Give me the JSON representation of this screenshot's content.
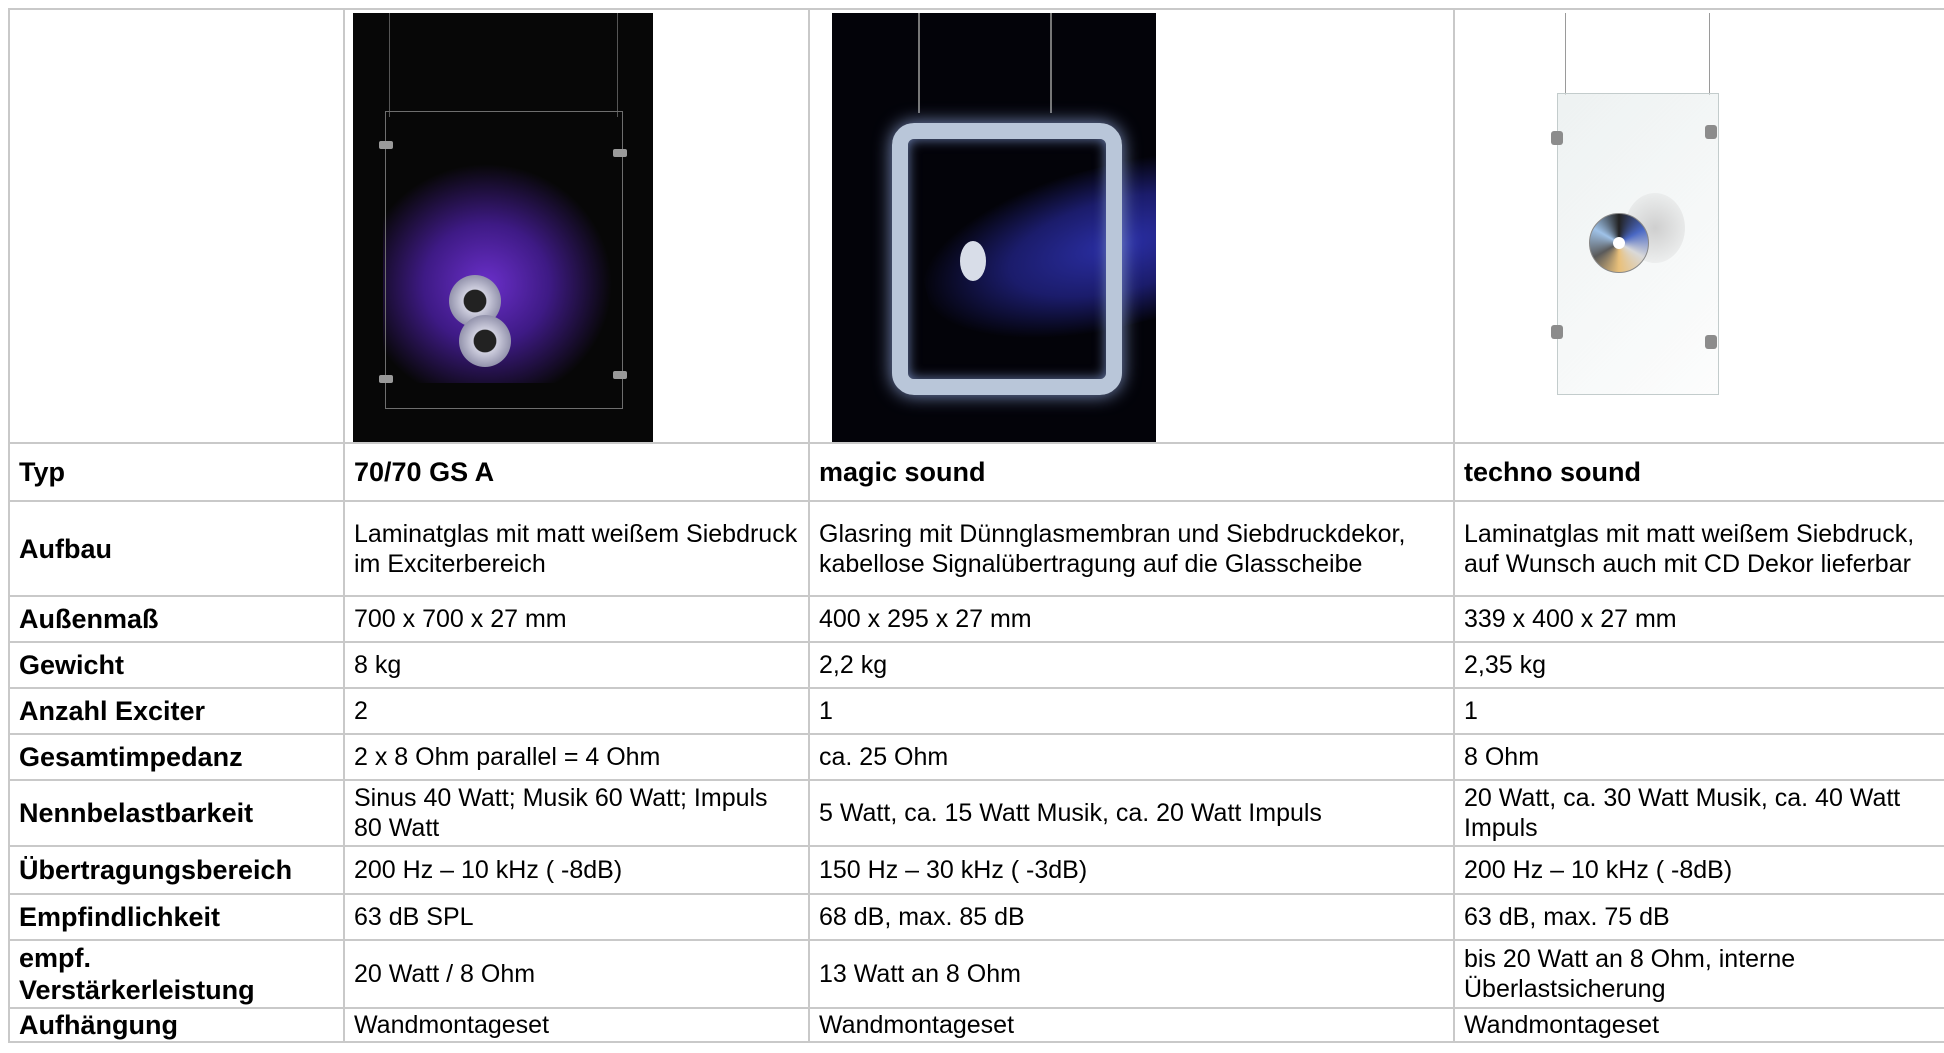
{
  "table": {
    "images": [
      {
        "icon": "suspended-glass-speaker-photo"
      },
      {
        "icon": "glass-ring-speaker-photo"
      },
      {
        "icon": "cd-decor-glass-speaker-photo"
      }
    ],
    "rows": [
      {
        "label": "Typ",
        "values": [
          "70/70 GS A",
          "magic sound",
          "techno sound"
        ]
      },
      {
        "label": "Aufbau",
        "values": [
          "Laminatglas mit matt weißem Siebdruck im Exciterbereich",
          "Glasring mit Dünnglasmembran und Siebdruckdekor, kabellose Signalübertragung auf die Glasscheibe",
          "Laminatglas mit matt weißem Siebdruck, auf Wunsch auch mit CD Dekor lieferbar"
        ]
      },
      {
        "label": "Außenmaß",
        "values": [
          "700 x 700 x 27 mm",
          "400 x 295 x 27 mm",
          "339 x 400 x 27 mm"
        ]
      },
      {
        "label": "Gewicht",
        "values": [
          "8 kg",
          "2,2 kg",
          "2,35 kg"
        ]
      },
      {
        "label": "Anzahl Exciter",
        "values": [
          "2",
          "1",
          "1"
        ]
      },
      {
        "label": "Gesamtimpedanz",
        "values": [
          "2 x 8 Ohm parallel = 4 Ohm",
          "ca. 25 Ohm",
          "8 Ohm"
        ]
      },
      {
        "label": "Nennbelastbarkeit",
        "values": [
          "Sinus 40 Watt; Musik 60 Watt; Impuls 80 Watt",
          "5 Watt, ca. 15 Watt Musik, ca. 20 Watt Impuls",
          "20 Watt, ca. 30 Watt Musik, ca. 40 Watt Impuls"
        ]
      },
      {
        "label": "Übertragungsbereich",
        "values": [
          "200 Hz – 10 kHz ( -8dB)",
          "150 Hz – 30 kHz ( -3dB)",
          "200 Hz – 10 kHz ( -8dB)"
        ]
      },
      {
        "label": "Empfindlichkeit",
        "values": [
          "63 dB SPL",
          "68 dB, max. 85 dB",
          "63 dB, max. 75 dB"
        ]
      },
      {
        "label": "empf. Verstärkerleistung",
        "values": [
          "20 Watt / 8 Ohm",
          "13 Watt an 8 Ohm",
          "bis 20 Watt an 8 Ohm, interne Überlastsicherung"
        ]
      },
      {
        "label": "Aufhängung",
        "values": [
          "Wandmontageset",
          "Wandmontageset",
          "Wandmontageset"
        ]
      }
    ]
  }
}
